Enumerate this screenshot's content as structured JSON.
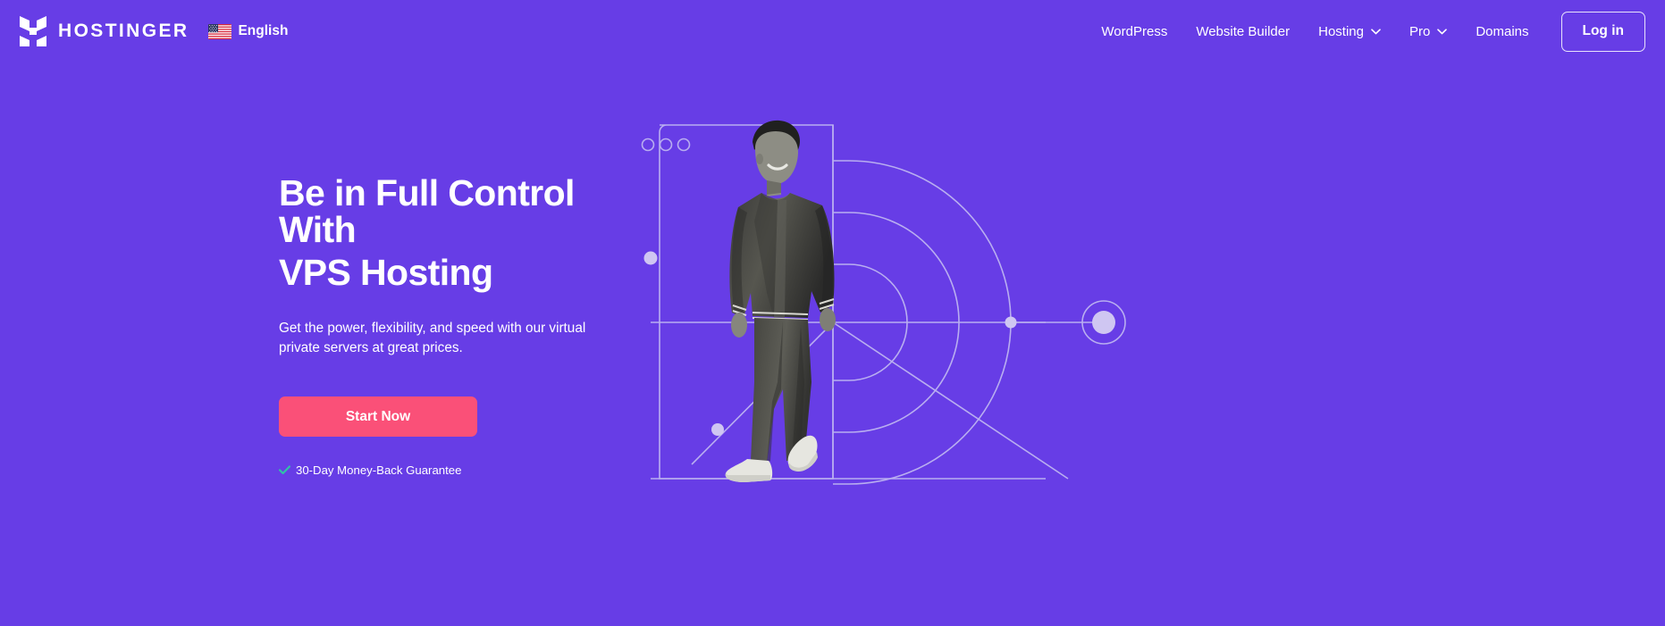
{
  "theme": {
    "background": "#673DE6",
    "accent_pink": "#FA5078",
    "check_teal": "#2EC4A6",
    "line": "#B9AEF0",
    "text_white": "#FFFFFF"
  },
  "header": {
    "logo": {
      "icon": "hostinger-h-logo-icon",
      "wordmark": "HOSTINGER"
    },
    "language": {
      "icon": "us-flag-icon",
      "label": "English"
    },
    "nav_items": [
      {
        "label": "WordPress",
        "has_dropdown": false
      },
      {
        "label": "Website Builder",
        "has_dropdown": false
      },
      {
        "label": "Hosting",
        "has_dropdown": true
      },
      {
        "label": "Pro",
        "has_dropdown": true
      },
      {
        "label": "Domains",
        "has_dropdown": false
      }
    ],
    "login_label": "Log in"
  },
  "hero": {
    "headline_line1": "Be in Full Control With",
    "headline_line2": "VPS Hosting",
    "subheadline": "Get the power, flexibility, and speed with our virtual private servers at great prices.",
    "cta_label": "Start Now",
    "guarantee_icon": "check-icon",
    "guarantee_text": "30-Day Money-Back Guarantee",
    "illustration": {
      "photo_alt": "smiling-man-walking-bomber-jacket",
      "decor": [
        "browser-window-frame",
        "three-window-dots",
        "wifi-signal-arcs",
        "connected-node-dots",
        "diagonal-lines"
      ]
    }
  }
}
